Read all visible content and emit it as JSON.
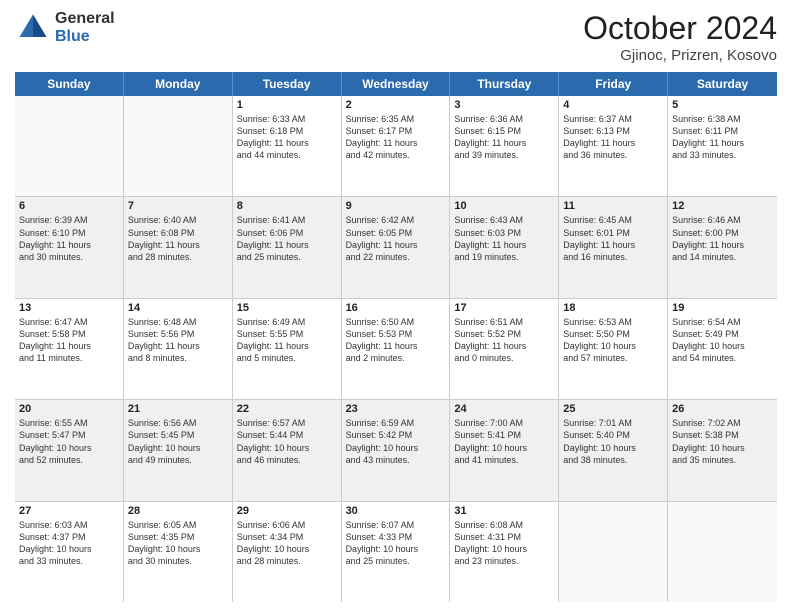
{
  "logo": {
    "general": "General",
    "blue": "Blue"
  },
  "title": "October 2024",
  "subtitle": "Gjinoc, Prizren, Kosovo",
  "weekdays": [
    "Sunday",
    "Monday",
    "Tuesday",
    "Wednesday",
    "Thursday",
    "Friday",
    "Saturday"
  ],
  "weeks": [
    [
      {
        "day": "",
        "lines": [],
        "empty": true
      },
      {
        "day": "",
        "lines": [],
        "empty": true
      },
      {
        "day": "1",
        "lines": [
          "Sunrise: 6:33 AM",
          "Sunset: 6:18 PM",
          "Daylight: 11 hours",
          "and 44 minutes."
        ]
      },
      {
        "day": "2",
        "lines": [
          "Sunrise: 6:35 AM",
          "Sunset: 6:17 PM",
          "Daylight: 11 hours",
          "and 42 minutes."
        ]
      },
      {
        "day": "3",
        "lines": [
          "Sunrise: 6:36 AM",
          "Sunset: 6:15 PM",
          "Daylight: 11 hours",
          "and 39 minutes."
        ]
      },
      {
        "day": "4",
        "lines": [
          "Sunrise: 6:37 AM",
          "Sunset: 6:13 PM",
          "Daylight: 11 hours",
          "and 36 minutes."
        ]
      },
      {
        "day": "5",
        "lines": [
          "Sunrise: 6:38 AM",
          "Sunset: 6:11 PM",
          "Daylight: 11 hours",
          "and 33 minutes."
        ]
      }
    ],
    [
      {
        "day": "6",
        "lines": [
          "Sunrise: 6:39 AM",
          "Sunset: 6:10 PM",
          "Daylight: 11 hours",
          "and 30 minutes."
        ]
      },
      {
        "day": "7",
        "lines": [
          "Sunrise: 6:40 AM",
          "Sunset: 6:08 PM",
          "Daylight: 11 hours",
          "and 28 minutes."
        ]
      },
      {
        "day": "8",
        "lines": [
          "Sunrise: 6:41 AM",
          "Sunset: 6:06 PM",
          "Daylight: 11 hours",
          "and 25 minutes."
        ]
      },
      {
        "day": "9",
        "lines": [
          "Sunrise: 6:42 AM",
          "Sunset: 6:05 PM",
          "Daylight: 11 hours",
          "and 22 minutes."
        ]
      },
      {
        "day": "10",
        "lines": [
          "Sunrise: 6:43 AM",
          "Sunset: 6:03 PM",
          "Daylight: 11 hours",
          "and 19 minutes."
        ]
      },
      {
        "day": "11",
        "lines": [
          "Sunrise: 6:45 AM",
          "Sunset: 6:01 PM",
          "Daylight: 11 hours",
          "and 16 minutes."
        ]
      },
      {
        "day": "12",
        "lines": [
          "Sunrise: 6:46 AM",
          "Sunset: 6:00 PM",
          "Daylight: 11 hours",
          "and 14 minutes."
        ]
      }
    ],
    [
      {
        "day": "13",
        "lines": [
          "Sunrise: 6:47 AM",
          "Sunset: 5:58 PM",
          "Daylight: 11 hours",
          "and 11 minutes."
        ]
      },
      {
        "day": "14",
        "lines": [
          "Sunrise: 6:48 AM",
          "Sunset: 5:56 PM",
          "Daylight: 11 hours",
          "and 8 minutes."
        ]
      },
      {
        "day": "15",
        "lines": [
          "Sunrise: 6:49 AM",
          "Sunset: 5:55 PM",
          "Daylight: 11 hours",
          "and 5 minutes."
        ]
      },
      {
        "day": "16",
        "lines": [
          "Sunrise: 6:50 AM",
          "Sunset: 5:53 PM",
          "Daylight: 11 hours",
          "and 2 minutes."
        ]
      },
      {
        "day": "17",
        "lines": [
          "Sunrise: 6:51 AM",
          "Sunset: 5:52 PM",
          "Daylight: 11 hours",
          "and 0 minutes."
        ]
      },
      {
        "day": "18",
        "lines": [
          "Sunrise: 6:53 AM",
          "Sunset: 5:50 PM",
          "Daylight: 10 hours",
          "and 57 minutes."
        ]
      },
      {
        "day": "19",
        "lines": [
          "Sunrise: 6:54 AM",
          "Sunset: 5:49 PM",
          "Daylight: 10 hours",
          "and 54 minutes."
        ]
      }
    ],
    [
      {
        "day": "20",
        "lines": [
          "Sunrise: 6:55 AM",
          "Sunset: 5:47 PM",
          "Daylight: 10 hours",
          "and 52 minutes."
        ]
      },
      {
        "day": "21",
        "lines": [
          "Sunrise: 6:56 AM",
          "Sunset: 5:45 PM",
          "Daylight: 10 hours",
          "and 49 minutes."
        ]
      },
      {
        "day": "22",
        "lines": [
          "Sunrise: 6:57 AM",
          "Sunset: 5:44 PM",
          "Daylight: 10 hours",
          "and 46 minutes."
        ]
      },
      {
        "day": "23",
        "lines": [
          "Sunrise: 6:59 AM",
          "Sunset: 5:42 PM",
          "Daylight: 10 hours",
          "and 43 minutes."
        ]
      },
      {
        "day": "24",
        "lines": [
          "Sunrise: 7:00 AM",
          "Sunset: 5:41 PM",
          "Daylight: 10 hours",
          "and 41 minutes."
        ]
      },
      {
        "day": "25",
        "lines": [
          "Sunrise: 7:01 AM",
          "Sunset: 5:40 PM",
          "Daylight: 10 hours",
          "and 38 minutes."
        ]
      },
      {
        "day": "26",
        "lines": [
          "Sunrise: 7:02 AM",
          "Sunset: 5:38 PM",
          "Daylight: 10 hours",
          "and 35 minutes."
        ]
      }
    ],
    [
      {
        "day": "27",
        "lines": [
          "Sunrise: 6:03 AM",
          "Sunset: 4:37 PM",
          "Daylight: 10 hours",
          "and 33 minutes."
        ]
      },
      {
        "day": "28",
        "lines": [
          "Sunrise: 6:05 AM",
          "Sunset: 4:35 PM",
          "Daylight: 10 hours",
          "and 30 minutes."
        ]
      },
      {
        "day": "29",
        "lines": [
          "Sunrise: 6:06 AM",
          "Sunset: 4:34 PM",
          "Daylight: 10 hours",
          "and 28 minutes."
        ]
      },
      {
        "day": "30",
        "lines": [
          "Sunrise: 6:07 AM",
          "Sunset: 4:33 PM",
          "Daylight: 10 hours",
          "and 25 minutes."
        ]
      },
      {
        "day": "31",
        "lines": [
          "Sunrise: 6:08 AM",
          "Sunset: 4:31 PM",
          "Daylight: 10 hours",
          "and 23 minutes."
        ]
      },
      {
        "day": "",
        "lines": [],
        "empty": true
      },
      {
        "day": "",
        "lines": [],
        "empty": true
      }
    ]
  ]
}
